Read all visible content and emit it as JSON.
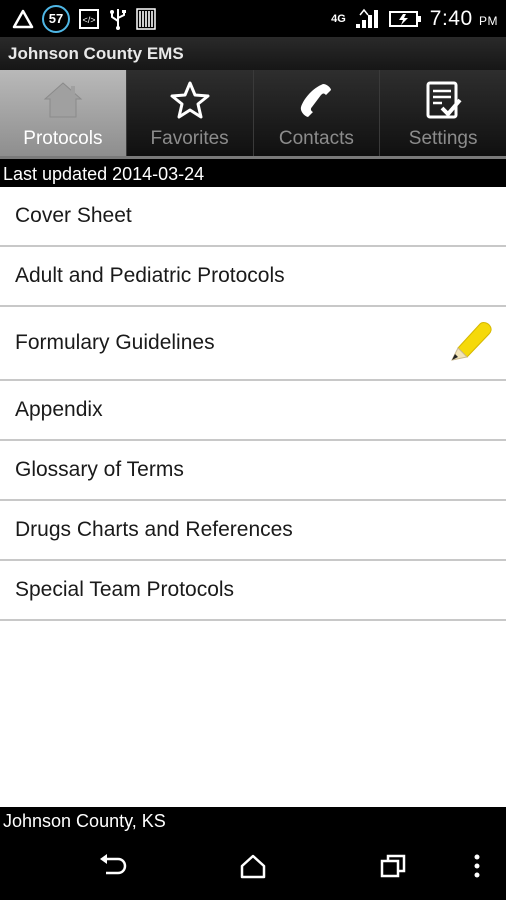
{
  "status_bar": {
    "notification_badge": "57",
    "network": "4G",
    "time": "7:40",
    "ampm": "PM"
  },
  "app_bar": {
    "title": "Johnson County EMS"
  },
  "tabs": [
    {
      "label": "Protocols",
      "icon": "home-icon",
      "active": true
    },
    {
      "label": "Favorites",
      "icon": "star-icon",
      "active": false
    },
    {
      "label": "Contacts",
      "icon": "phone-icon",
      "active": false
    },
    {
      "label": "Settings",
      "icon": "checklist-icon",
      "active": false
    }
  ],
  "last_updated": "Last updated 2014-03-24",
  "list": {
    "items": [
      {
        "label": "Cover Sheet"
      },
      {
        "label": "Adult and Pediatric Protocols"
      },
      {
        "label": "Formulary Guidelines",
        "marker": "pencil-icon"
      },
      {
        "label": "Appendix"
      },
      {
        "label": "Glossary of Terms"
      },
      {
        "label": "Drugs Charts and References"
      },
      {
        "label": "Special Team Protocols"
      }
    ]
  },
  "footer": {
    "location": "Johnson County, KS"
  },
  "colors": {
    "accent_badge": "#4fb7e6",
    "pencil": "#f5d90a",
    "tab_active": "#a5a5a5"
  }
}
